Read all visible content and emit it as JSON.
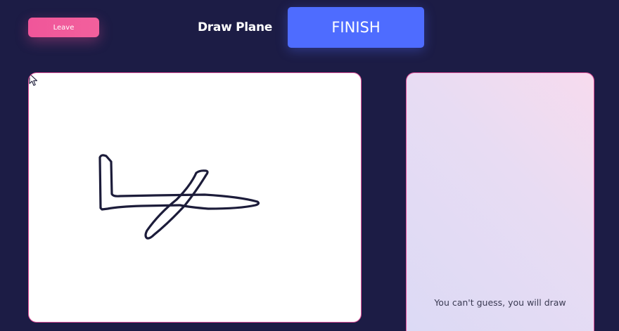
{
  "header": {
    "leave_label": "Leave",
    "title": "Draw Plane",
    "finish_label": "FINISH"
  },
  "canvas": {
    "stroke_color": "#1c1c3a"
  },
  "guess_panel": {
    "hint": "You can't guess, you will draw"
  },
  "colors": {
    "background": "#1c1c45",
    "leave_button": "#f0569a",
    "finish_button": "#4e6cff",
    "panel_border": "#e0509a"
  }
}
